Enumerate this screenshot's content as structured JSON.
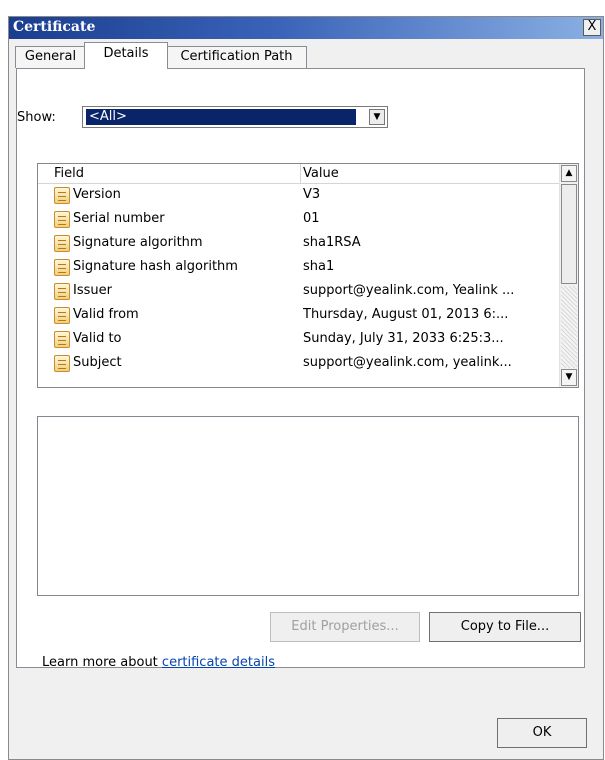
{
  "window": {
    "title": "Certificate",
    "close_label": "X"
  },
  "tabs": [
    {
      "label": "General"
    },
    {
      "label": "Details"
    },
    {
      "label": "Certification Path"
    }
  ],
  "show": {
    "label": "Show:",
    "selected": "<All>"
  },
  "list": {
    "headers": {
      "field": "Field",
      "value": "Value"
    },
    "rows": [
      {
        "field": "Version",
        "value": "V3"
      },
      {
        "field": "Serial number",
        "value": "01"
      },
      {
        "field": "Signature algorithm",
        "value": "sha1RSA"
      },
      {
        "field": "Signature hash algorithm",
        "value": "sha1"
      },
      {
        "field": "Issuer",
        "value": "support@yealink.com, Yealink ..."
      },
      {
        "field": "Valid from",
        "value": "Thursday, August 01, 2013 6:..."
      },
      {
        "field": "Valid to",
        "value": "Sunday, July 31, 2033 6:25:3..."
      },
      {
        "field": "Subject",
        "value": "support@yealink.com, yealink..."
      }
    ]
  },
  "buttons": {
    "edit_properties": "Edit Properties...",
    "copy_to_file": "Copy to File...",
    "ok": "OK"
  },
  "learn_more": {
    "prefix": "Learn more about ",
    "link": "certificate details"
  }
}
